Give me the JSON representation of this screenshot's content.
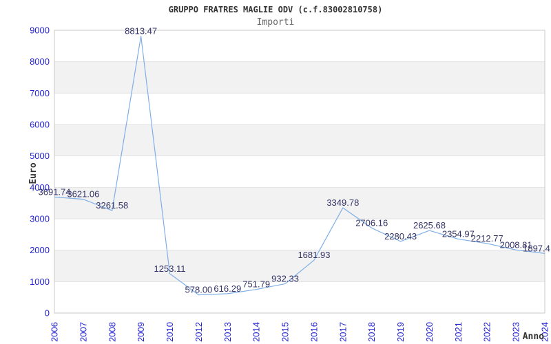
{
  "header": {
    "title": "GRUPPO FRATRES MAGLIE ODV (c.f.83002810758)",
    "subtitle": "Importi"
  },
  "chart_data": {
    "type": "line",
    "title": "GRUPPO FRATRES MAGLIE ODV (c.f.83002810758)",
    "subtitle": "Importi",
    "xlabel": "Anno",
    "ylabel": "Euro",
    "categories": [
      "2006",
      "2007",
      "2008",
      "2009",
      "2010",
      "2012",
      "2013",
      "2014",
      "2015",
      "2016",
      "2017",
      "2018",
      "2019",
      "2020",
      "2021",
      "2022",
      "2023",
      "2024"
    ],
    "values": [
      3691.74,
      3621.06,
      3261.58,
      8813.47,
      1253.11,
      578.0,
      616.29,
      751.79,
      932.33,
      1681.93,
      3349.78,
      2706.16,
      2280.43,
      2625.68,
      2354.97,
      2212.77,
      2008.81,
      1897.4
    ],
    "point_labels": [
      "3691.74",
      "3621.06",
      "3261.58",
      "8813.47",
      "1253.11",
      "578.00",
      "616.29",
      "751.79",
      "932.33",
      "1681.93",
      "3349.78",
      "2706.16",
      "2280.43",
      "2625.68",
      "2354.97",
      "2212.77",
      "2008.81",
      "1897.4"
    ],
    "ylim": [
      0,
      9000
    ],
    "ytick_step": 1000,
    "grid": "horizontal-alternating-bands",
    "legend_position": "none",
    "colors": {
      "line": "#7fafe6",
      "tick_label": "#2323d2",
      "point_label": "#333366",
      "band": "#f2f2f2",
      "gridline": "#e2e2e2",
      "frame": "#c8c8c8",
      "title": "#333333",
      "subtitle": "#666666",
      "axis_name": "#333333",
      "background": "#ffffff"
    }
  }
}
